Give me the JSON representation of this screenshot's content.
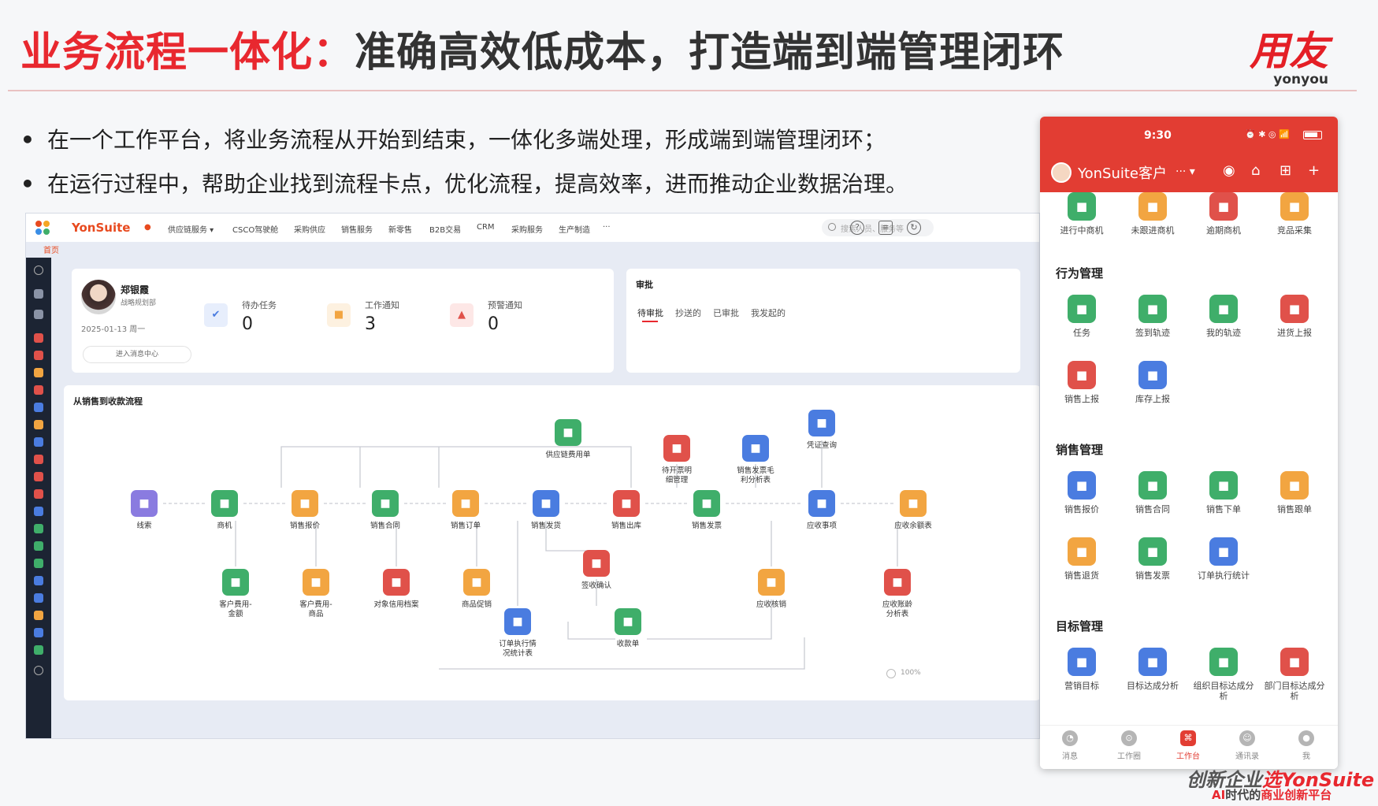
{
  "slide": {
    "title_red": "业务流程一体化：",
    "title_dark": "准确高效低成本，打造端到端管理闭环",
    "bullets": [
      "在一个工作平台，将业务流程从开始到结束，一体化多端处理，形成端到端管理闭环；",
      "在运行过程中，帮助企业找到流程卡点，优化流程，提高效率，进而推动企业数据治理。"
    ],
    "bullet_symbol": "•"
  },
  "logo": {
    "zh": "用友",
    "en": "yonyou"
  },
  "desktop": {
    "brand": "YonSuite",
    "nav": [
      "供应链服务 ▾",
      "CSCO驾驶舱",
      "采购供应",
      "销售服务",
      "新零售",
      "B2B交易",
      "CRM",
      "采购服务",
      "生产制造",
      "···"
    ],
    "search_placeholder": "搜索人员、服务等",
    "breadcrumb": "首页",
    "profile": {
      "name": "郑银霞",
      "role": "战略规划部",
      "date": "2025-01-13 周一",
      "message_center": "进入消息中心"
    },
    "stats": [
      {
        "label": "待办任务",
        "value": "0"
      },
      {
        "label": "工作通知",
        "value": "3"
      },
      {
        "label": "预警通知",
        "value": "0"
      }
    ],
    "approval": {
      "title": "审批",
      "tabs": [
        "待审批",
        "抄送的",
        "已审批",
        "我发起的"
      ]
    },
    "flow": {
      "title": "从销售到收款流程",
      "zoom": "100%",
      "nodes": [
        {
          "label": "线索",
          "color": "#8a7be0"
        },
        {
          "label": "商机",
          "color": "#3fae6a"
        },
        {
          "label": "销售报价",
          "color": "#f2a541"
        },
        {
          "label": "销售合同",
          "color": "#3fae6a"
        },
        {
          "label": "销售订单",
          "color": "#f2a541"
        },
        {
          "label": "销售发货",
          "color": "#4a7ce0"
        },
        {
          "label": "销售出库",
          "color": "#e0514a"
        },
        {
          "label": "销售发票",
          "color": "#3fae6a"
        },
        {
          "label": "应收事项",
          "color": "#4a7ce0"
        },
        {
          "label": "应收余额表",
          "color": "#f2a541"
        },
        {
          "label": "供应链费用单",
          "color": "#3fae6a"
        },
        {
          "label": "待开票明\n细管理",
          "color": "#e0514a"
        },
        {
          "label": "销售发票毛\n利分析表",
          "color": "#4a7ce0"
        },
        {
          "label": "凭证查询",
          "color": "#4a7ce0"
        },
        {
          "label": "客户费用-\n金额",
          "color": "#3fae6a"
        },
        {
          "label": "客户费用-\n商品",
          "color": "#f2a541"
        },
        {
          "label": "对象信用档案",
          "color": "#e0514a"
        },
        {
          "label": "商品促销",
          "color": "#f2a541"
        },
        {
          "label": "签收确认",
          "color": "#e0514a"
        },
        {
          "label": "应收核销",
          "color": "#f2a541"
        },
        {
          "label": "应收账龄\n分析表",
          "color": "#e0514a"
        },
        {
          "label": "订单执行情\n况统计表",
          "color": "#4a7ce0"
        },
        {
          "label": "收款单",
          "color": "#3fae6a"
        }
      ]
    }
  },
  "mobile": {
    "time": "9:30",
    "status_icons": "⏰ ✱ ◎ 📶",
    "app_name": "YonSuite客户",
    "menu": "··· ▾",
    "top_items": [
      {
        "label": "进行中商机",
        "color": "#3fae6a"
      },
      {
        "label": "未跟进商机",
        "color": "#f2a541"
      },
      {
        "label": "逾期商机",
        "color": "#e0514a"
      },
      {
        "label": "竞品采集",
        "color": "#f2a541"
      }
    ],
    "sections": [
      {
        "title": "行为管理",
        "items": [
          {
            "label": "任务",
            "color": "#3fae6a"
          },
          {
            "label": "签到轨迹",
            "color": "#3fae6a"
          },
          {
            "label": "我的轨迹",
            "color": "#3fae6a"
          },
          {
            "label": "进货上报",
            "color": "#e0514a"
          },
          {
            "label": "销售上报",
            "color": "#e0514a"
          },
          {
            "label": "库存上报",
            "color": "#4a7ce0"
          }
        ]
      },
      {
        "title": "销售管理",
        "items": [
          {
            "label": "销售报价",
            "color": "#4a7ce0"
          },
          {
            "label": "销售合同",
            "color": "#3fae6a"
          },
          {
            "label": "销售下单",
            "color": "#3fae6a"
          },
          {
            "label": "销售跟单",
            "color": "#f2a541"
          },
          {
            "label": "销售退货",
            "color": "#f2a541"
          },
          {
            "label": "销售发票",
            "color": "#3fae6a"
          },
          {
            "label": "订单执行统计",
            "color": "#4a7ce0"
          }
        ]
      },
      {
        "title": "目标管理",
        "items": [
          {
            "label": "营销目标",
            "color": "#4a7ce0"
          },
          {
            "label": "目标达成分析",
            "color": "#4a7ce0"
          },
          {
            "label": "组织目标达成分\n析",
            "color": "#3fae6a"
          },
          {
            "label": "部门目标达成分\n析",
            "color": "#e0514a"
          }
        ]
      }
    ],
    "tabs": [
      {
        "label": "消息"
      },
      {
        "label": "工作圈"
      },
      {
        "label": "工作台"
      },
      {
        "label": "通讯录"
      },
      {
        "label": "我"
      }
    ]
  },
  "footer": {
    "line1_a": "创新企业",
    "line1_b": "选YonSuite",
    "line2_a": "AI",
    "line2_b": "时代的",
    "line2_c": "商业创新平台"
  }
}
